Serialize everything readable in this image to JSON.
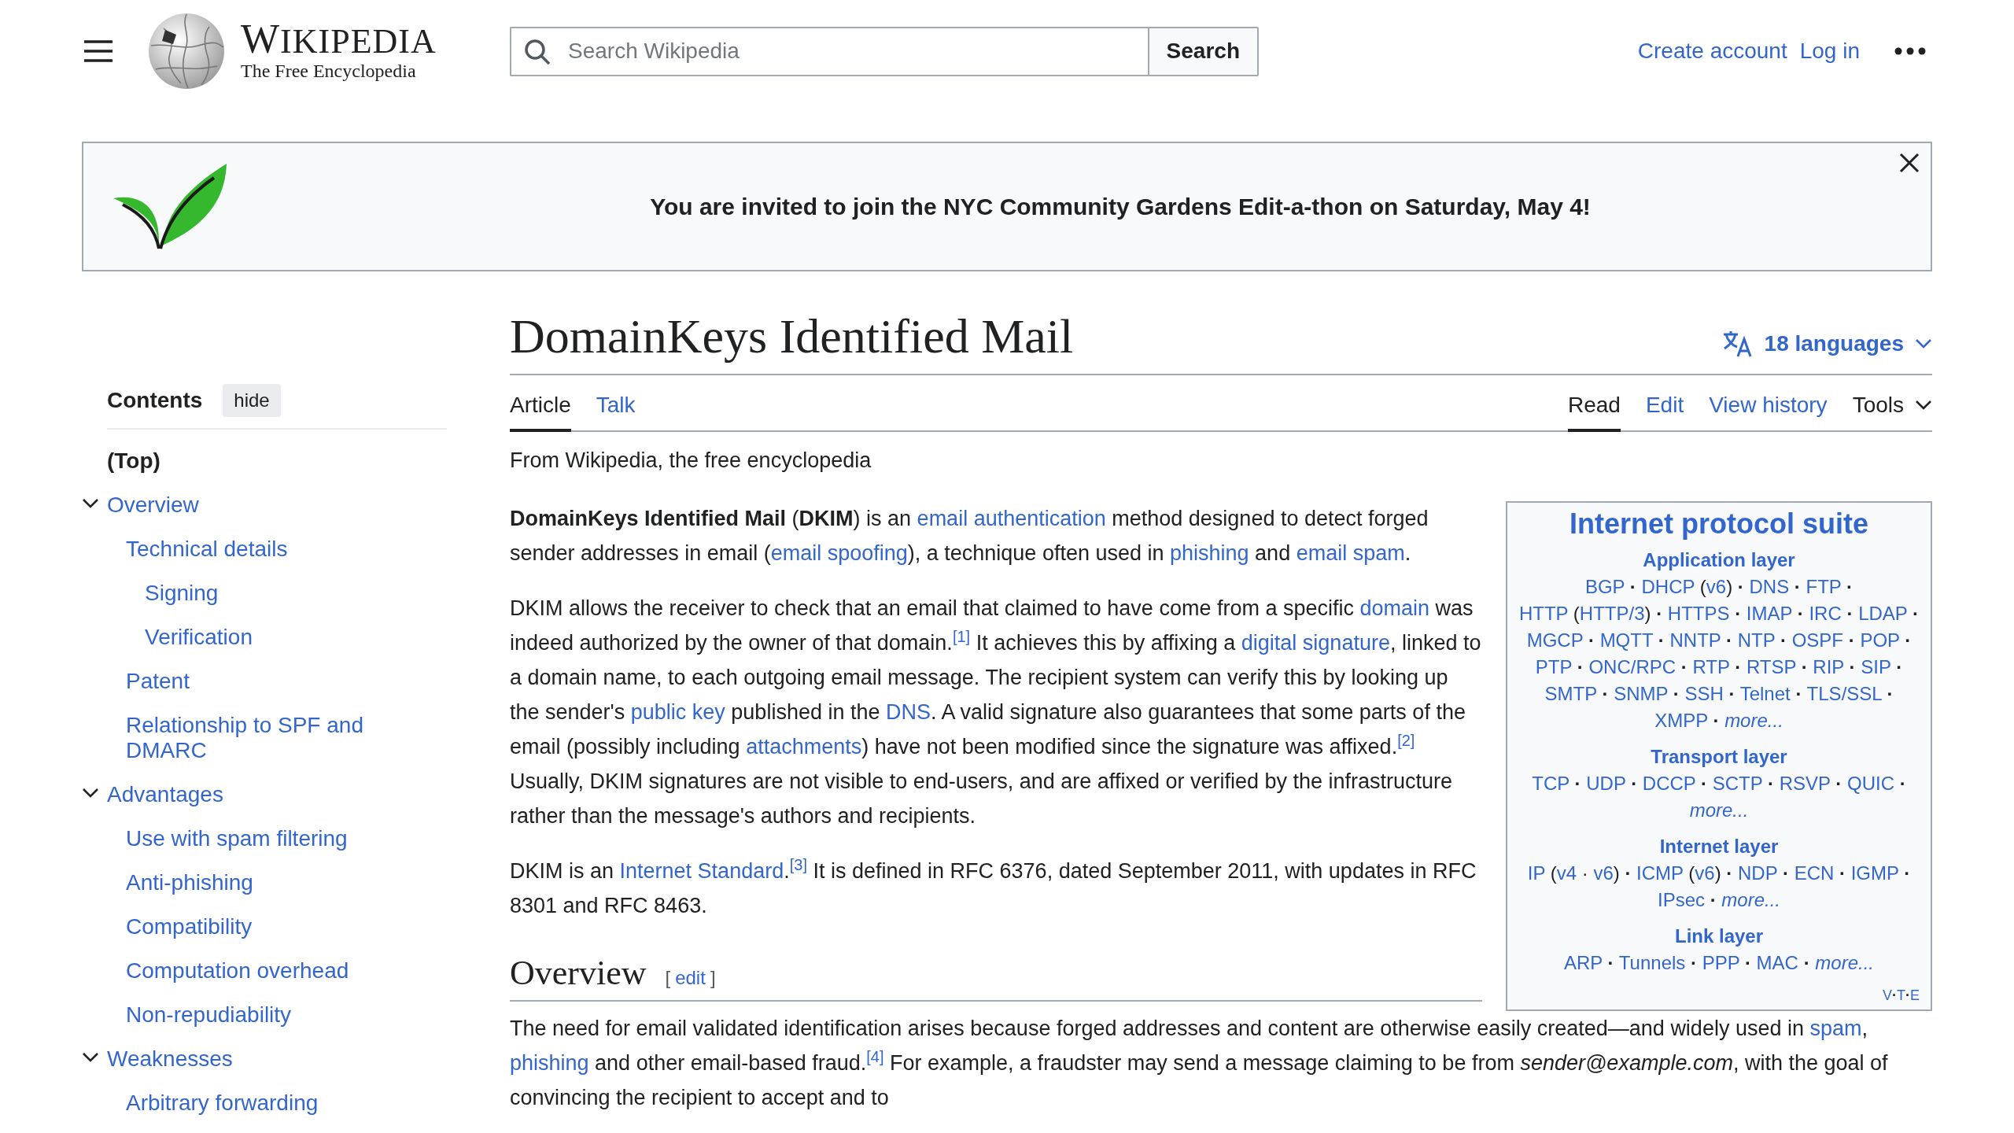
{
  "header": {
    "wordmark": "WIKIPEDIA",
    "tagline": "The Free Encyclopedia",
    "search": {
      "placeholder": "Search Wikipedia",
      "button": "Search"
    },
    "user_links": [
      "Create account",
      "Log in"
    ]
  },
  "banner": {
    "message": "You are invited to join the NYC Community Gardens Edit-a-thon on Saturday, May 4!"
  },
  "toc": {
    "title": "Contents",
    "toggle": "hide",
    "items": [
      {
        "label": "(Top)",
        "selected": true
      },
      {
        "label": "Overview",
        "selected": false,
        "expanded": true,
        "children": [
          {
            "label": "Technical details",
            "selected": false,
            "children": [
              {
                "label": "Signing",
                "selected": false
              },
              {
                "label": "Verification",
                "selected": false
              }
            ]
          },
          {
            "label": "Patent",
            "selected": false
          },
          {
            "label": "Relationship to SPF and DMARC",
            "selected": false
          }
        ]
      },
      {
        "label": "Advantages",
        "selected": false,
        "expanded": true,
        "children": [
          {
            "label": "Use with spam filtering",
            "selected": false
          },
          {
            "label": "Anti-phishing",
            "selected": false
          },
          {
            "label": "Compatibility",
            "selected": false
          },
          {
            "label": "Computation overhead",
            "selected": false
          },
          {
            "label": "Non-repudiability",
            "selected": false
          }
        ]
      },
      {
        "label": "Weaknesses",
        "selected": false,
        "expanded": true,
        "children": [
          {
            "label": "Arbitrary forwarding",
            "selected": false
          }
        ]
      }
    ]
  },
  "article": {
    "title": "DomainKeys Identified Mail",
    "languages": "18 languages",
    "tabs_left": [
      {
        "label": "Article",
        "selected": true
      },
      {
        "label": "Talk",
        "selected": false
      }
    ],
    "tabs_right": [
      {
        "label": "Read",
        "selected": true,
        "kind": "tab"
      },
      {
        "label": "Edit",
        "selected": false,
        "kind": "tab"
      },
      {
        "label": "View history",
        "selected": false,
        "kind": "tab"
      },
      {
        "label": "Tools",
        "selected": false,
        "kind": "menu"
      }
    ],
    "tagline": "From Wikipedia, the free encyclopedia",
    "lead": [
      [
        {
          "text": "**DomainKeys Identified Mail** (**DKIM**) is an "
        },
        {
          "link": "email authentication"
        },
        {
          "text": " method designed to detect forged sender addresses in email ("
        },
        {
          "link": "email spoofing"
        },
        {
          "text": "), a technique often used in "
        },
        {
          "link": "phishing"
        },
        {
          "text": " and "
        },
        {
          "link": "email spam"
        },
        {
          "text": "."
        }
      ],
      [
        {
          "text": "DKIM allows the receiver to check that an email that claimed to have come from a specific "
        },
        {
          "link": "domain"
        },
        {
          "text": " was indeed authorized by the owner of that domain."
        },
        {
          "ref": "[1]"
        },
        {
          "text": " It achieves this by affixing a "
        },
        {
          "link": "digital signature"
        },
        {
          "text": ", linked to a domain name, to each outgoing email message. The recipient system can verify this by looking up the sender's "
        },
        {
          "link": "public key"
        },
        {
          "text": " published in the "
        },
        {
          "link": "DNS"
        },
        {
          "text": ". A valid signature also guarantees that some parts of the email (possibly including "
        },
        {
          "link": "attachments"
        },
        {
          "text": ") have not been modified since the signature was affixed."
        },
        {
          "ref": "[2]"
        },
        {
          "text": " Usually, DKIM signatures are not visible to end-users, and are affixed or verified by the infrastructure rather than the message's authors and recipients."
        }
      ],
      [
        {
          "text": "DKIM is an "
        },
        {
          "link": "Internet Standard"
        },
        {
          "text": "."
        },
        {
          "ref": "[3]"
        },
        {
          "text": " It is defined in RFC 6376, dated September 2011, with updates in RFC 8301 and RFC 8463."
        }
      ]
    ],
    "infobox": {
      "title": "Internet protocol suite",
      "separator": "·",
      "sections": [
        {
          "heading": "Application layer",
          "items": [
            {
              "link": "BGP"
            },
            {
              "parts": [
                {
                  "link": "DHCP"
                },
                {
                  "text": " ("
                },
                {
                  "link": "v6"
                },
                {
                  "text": ")"
                }
              ]
            },
            {
              "link": "DNS"
            },
            {
              "link": "FTP"
            },
            {
              "parts": [
                {
                  "link": "HTTP"
                },
                {
                  "text": " ("
                },
                {
                  "link": "HTTP/3"
                },
                {
                  "text": ")"
                }
              ]
            },
            {
              "link": "HTTPS"
            },
            {
              "link": "IMAP"
            },
            {
              "link": "IRC"
            },
            {
              "link": "LDAP"
            },
            {
              "link": "MGCP"
            },
            {
              "link": "MQTT"
            },
            {
              "link": "NNTP"
            },
            {
              "link": "NTP"
            },
            {
              "link": "OSPF"
            },
            {
              "link": "POP"
            },
            {
              "link": "PTP"
            },
            {
              "link": "ONC/RPC"
            },
            {
              "link": "RTP"
            },
            {
              "link": "RTSP"
            },
            {
              "link": "RIP"
            },
            {
              "link": "SIP"
            },
            {
              "link": "SMTP"
            },
            {
              "link": "SNMP"
            },
            {
              "link": "SSH"
            },
            {
              "link": "Telnet"
            },
            {
              "link": "TLS/SSL"
            },
            {
              "link": "XMPP"
            },
            {
              "more": "more..."
            }
          ]
        },
        {
          "heading": "Transport layer",
          "items": [
            {
              "link": "TCP"
            },
            {
              "link": "UDP"
            },
            {
              "link": "DCCP"
            },
            {
              "link": "SCTP"
            },
            {
              "link": "RSVP"
            },
            {
              "link": "QUIC"
            },
            {
              "more": "more..."
            }
          ]
        },
        {
          "heading": "Internet layer",
          "items": [
            {
              "parts": [
                {
                  "link": "IP"
                },
                {
                  "text": " ("
                },
                {
                  "link": "v4"
                },
                {
                  "text": " · "
                },
                {
                  "link": "v6"
                },
                {
                  "text": ")"
                }
              ]
            },
            {
              "parts": [
                {
                  "link": "ICMP"
                },
                {
                  "text": " ("
                },
                {
                  "link": "v6"
                },
                {
                  "text": ")"
                }
              ]
            },
            {
              "link": "NDP"
            },
            {
              "link": "ECN"
            },
            {
              "link": "IGMP"
            },
            {
              "link": "IPsec"
            },
            {
              "more": "more..."
            }
          ]
        },
        {
          "heading": "Link layer",
          "items": [
            {
              "link": "ARP"
            },
            {
              "link": "Tunnels"
            },
            {
              "link": "PPP"
            },
            {
              "link": "MAC"
            },
            {
              "more": "more..."
            }
          ]
        }
      ],
      "vte": [
        "V",
        "T",
        "E"
      ]
    },
    "sections": [
      {
        "heading": "Overview",
        "edit": {
          "open": "[",
          "label": "edit",
          "close": "]"
        },
        "paragraphs": [
          [
            {
              "text": "The need for email validated identification arises because forged addresses and content are otherwise easily created—and widely used in "
            },
            {
              "link": "spam"
            },
            {
              "text": ", "
            },
            {
              "link": "phishing"
            },
            {
              "text": " and other email-based fraud."
            },
            {
              "ref": "[4]"
            },
            {
              "text": " For example, a fraudster may send a message claiming to be from *sender@example.com*, with the goal of convincing the recipient to accept and to"
            }
          ]
        ]
      }
    ]
  }
}
